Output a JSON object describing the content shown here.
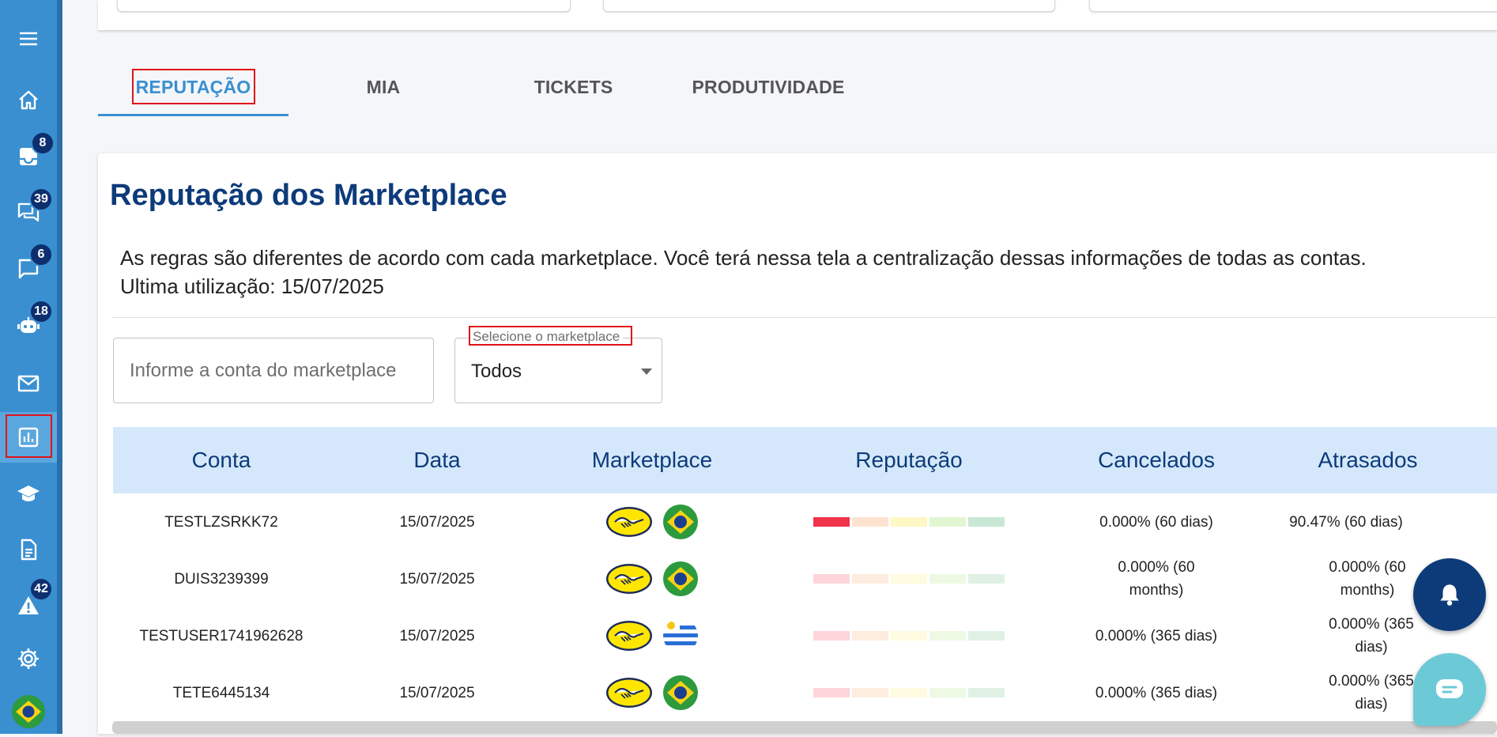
{
  "sidebar": {
    "items": [
      {
        "name": "menu-icon",
        "badge": ""
      },
      {
        "name": "home-icon",
        "badge": ""
      },
      {
        "name": "inbox-icon",
        "badge": "8"
      },
      {
        "name": "chat-icon",
        "badge": "39"
      },
      {
        "name": "message-icon",
        "badge": "6"
      },
      {
        "name": "bot-icon",
        "badge": "18"
      },
      {
        "name": "mail-icon",
        "badge": ""
      },
      {
        "name": "reports-icon",
        "badge": "",
        "active": true
      },
      {
        "name": "training-icon",
        "badge": ""
      },
      {
        "name": "document-icon",
        "badge": ""
      },
      {
        "name": "warning-icon",
        "badge": "42"
      },
      {
        "name": "settings-icon",
        "badge": ""
      },
      {
        "name": "brazil-flag-icon",
        "badge": ""
      }
    ],
    "badges": {
      "inbox": "8",
      "chat": "39",
      "message": "6",
      "bot": "18",
      "warning": "42"
    }
  },
  "tabs": [
    {
      "label": "REPUTAÇÃO",
      "active": true
    },
    {
      "label": "MIA"
    },
    {
      "label": "TICKETS"
    },
    {
      "label": "PRODUTIVIDADE"
    }
  ],
  "panel": {
    "title": "Reputação dos Marketplace",
    "description_line1": "As regras são diferentes de acordo com cada marketplace. Você terá nessa tela a centralização dessas informações de todas as contas.",
    "description_line2": "Ultima utilização: 15/07/2025"
  },
  "filters": {
    "account_placeholder": "Informe a conta do marketplace",
    "marketplace_label": "Selecione o marketplace",
    "marketplace_value": "Todos"
  },
  "table": {
    "headers": [
      "Conta",
      "Data",
      "Marketplace",
      "Reputação",
      "Cancelados",
      "Atrasados"
    ],
    "rows": [
      {
        "conta": "TESTLZSRKK72",
        "data": "15/07/2025",
        "marketplace_icon": "mercadolivre-icon",
        "country_icon": "brazil-flag-icon",
        "reputation_level": 1,
        "cancelados": "0.000% (60 dias)",
        "atrasados": "90.47% (60 dias)"
      },
      {
        "conta": "DUIS3239399",
        "data": "15/07/2025",
        "marketplace_icon": "mercadolivre-icon",
        "country_icon": "brazil-flag-icon",
        "reputation_level": 0,
        "cancelados": "0.000% (60 months)",
        "atrasados": "0.000% (60 months)"
      },
      {
        "conta": "TESTUSER1741962628",
        "data": "15/07/2025",
        "marketplace_icon": "mercadolivre-icon",
        "country_icon": "uruguay-flag-icon",
        "reputation_level": 0,
        "cancelados": "0.000% (365 dias)",
        "atrasados": "0.000% (365 dias)"
      },
      {
        "conta": "TETE6445134",
        "data": "15/07/2025",
        "marketplace_icon": "mercadolivre-icon",
        "country_icon": "brazil-flag-icon",
        "reputation_level": 0,
        "cancelados": "0.000% (365 dias)",
        "atrasados": "0.000% (365 dias)"
      }
    ]
  },
  "colors": {
    "sidebar": "#3a8fd0",
    "accent": "#3a8fd0",
    "title": "#0d3b7a",
    "table_header_bg": "#d5e8fb",
    "reputation_scale": [
      "#f0324b",
      "#fde3cf",
      "#fdf8c4",
      "#e3f6d2",
      "#c8e8d5"
    ],
    "reputation_scale_faded": [
      "#fdd5da",
      "#fdeddf",
      "#fefbe0",
      "#eef9e4",
      "#dff1e5"
    ]
  }
}
